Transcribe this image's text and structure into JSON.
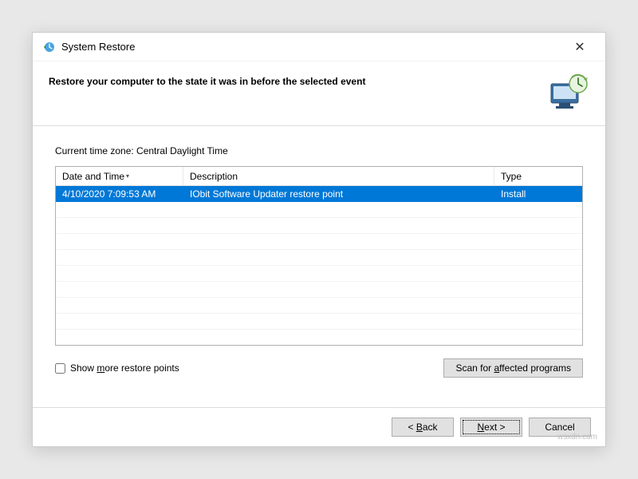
{
  "window": {
    "title": "System Restore",
    "close_label": "✕"
  },
  "header": {
    "heading": "Restore your computer to the state it was in before the selected event"
  },
  "timezone_prefix": "Current time zone: ",
  "timezone_value": "Central Daylight Time",
  "table": {
    "columns": {
      "date": "Date and Time",
      "desc": "Description",
      "type": "Type"
    },
    "sort_indicator": "▾",
    "rows": [
      {
        "date": "4/10/2020 7:09:53 AM",
        "desc": "IObit Software Updater restore point",
        "type": "Install",
        "selected": true
      }
    ]
  },
  "options": {
    "show_more_label": "Show more restore points",
    "scan_button": "Scan for affected programs"
  },
  "footer": {
    "back": "< Back",
    "next": "Next >",
    "cancel": "Cancel"
  },
  "watermark": "wsxdn.com"
}
